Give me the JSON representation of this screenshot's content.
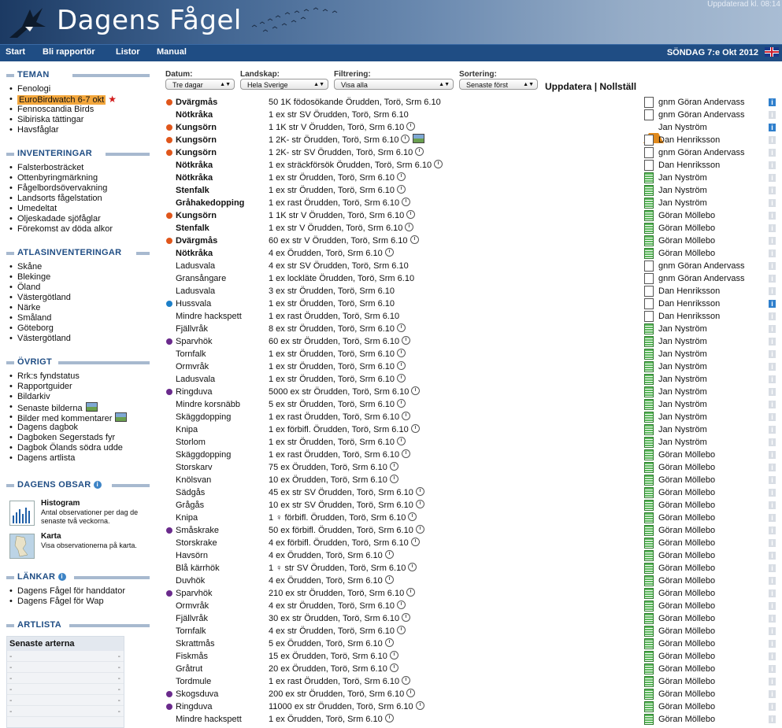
{
  "header": {
    "title": "Dagens Fågel",
    "updated": "Uppdaterad kl. 08:14"
  },
  "nav": {
    "items": [
      "Start",
      "Bli rapportör",
      "Listor",
      "Manual"
    ],
    "date": "SÖNDAG 7:e Okt 2012"
  },
  "sidebar": {
    "teman": {
      "title": "TEMAN",
      "items": [
        "Fenologi",
        "EuroBirdwatch 6-7 okt",
        "Fennoscandia Birds",
        "Sibiriska tättingar",
        "Havsfåglar"
      ]
    },
    "inventeringar": {
      "title": "INVENTERINGAR",
      "items": [
        "Falsterbosträcket",
        "Ottenbyringmärkning",
        "Fågelbordsövervakning",
        "Landsorts fågelstation",
        "Umedeltat",
        "Oljeskadade sjöfåglar",
        "Förekomst av döda alkor"
      ]
    },
    "atlas": {
      "title": "ATLASINVENTERINGAR",
      "items": [
        "Skåne",
        "Blekinge",
        "Öland",
        "Västergötland",
        "Närke",
        "Småland",
        "Göteborg",
        "Västergötland"
      ]
    },
    "ovrigt": {
      "title": "ÖVRIGT",
      "items": [
        "Rrk:s fyndstatus",
        "Rapportguider",
        "Bildarkiv",
        "Senaste bilderna",
        "Bilder med kommentarer",
        "Dagens dagbok",
        "Dagboken Segerstads fyr",
        "Dagbok Ölands södra udde",
        "Dagens artlista"
      ]
    },
    "obsar": {
      "title": "DAGENS OBSAR",
      "histogram_title": "Histogram",
      "histogram_desc": "Antal observationer per dag de senaste två veckorna.",
      "karta_title": "Karta",
      "karta_desc": "Visa observationerna på karta."
    },
    "lankar": {
      "title": "LÄNKAR",
      "items": [
        "Dagens Fågel för handdator",
        "Dagens Fågel för Wap"
      ]
    },
    "artlista": {
      "title": "ARTLISTA",
      "box_title": "Senaste arterna",
      "dash": "-"
    }
  },
  "filters": {
    "datum_label": "Datum:",
    "datum_value": "Tre dagar",
    "landskap_label": "Landskap:",
    "landskap_value": "Hela Sverige",
    "filtrering_label": "Filtrering:",
    "filtrering_value": "Visa alla",
    "sortering_label": "Sortering:",
    "sortering_value": "Senaste först",
    "uppdatera": "Uppdatera",
    "sep": "|",
    "nollstall": "Nollställ"
  },
  "colors": {
    "orange": "#e0561b",
    "blue": "#1c7fc8",
    "purple": "#6a2a8c"
  },
  "observations": [
    {
      "species": "Dvärgmås",
      "bold": true,
      "dot": "orange",
      "obs": "50 1K födosökande Örudden, Torö, Srm 6.10",
      "clock": false,
      "camera": false,
      "icon": "doc",
      "reporter": "gnm Göran Andervass",
      "info": true
    },
    {
      "species": "Nötkråka",
      "bold": true,
      "dot": "",
      "obs": "1 ex str SV Örudden, Torö, Srm 6.10",
      "clock": false,
      "camera": false,
      "icon": "doc",
      "reporter": "gnm Göran Andervass",
      "info": false
    },
    {
      "species": "Kungsörn",
      "bold": true,
      "dot": "orange",
      "obs": "1 1K str V Örudden, Torö, Srm 6.10",
      "clock": true,
      "camera": false,
      "icon": "warn",
      "reporter": "Jan Nyström",
      "info": true
    },
    {
      "species": "Kungsörn",
      "bold": true,
      "dot": "orange",
      "obs": "1 2K- str Örudden, Torö, Srm 6.10",
      "clock": true,
      "camera": true,
      "icon": "doc",
      "reporter": "Dan Henriksson",
      "info": false
    },
    {
      "species": "Kungsörn",
      "bold": true,
      "dot": "orange",
      "obs": "1 2K- str SV Örudden, Torö, Srm 6.10",
      "clock": true,
      "camera": false,
      "icon": "doc",
      "reporter": "gnm Göran Andervass",
      "info": false
    },
    {
      "species": "Nötkråka",
      "bold": true,
      "dot": "",
      "obs": "1 ex sträckförsök Örudden, Torö, Srm 6.10",
      "clock": true,
      "camera": false,
      "icon": "doc",
      "reporter": "Dan Henriksson",
      "info": false
    },
    {
      "species": "Nötkråka",
      "bold": true,
      "dot": "",
      "obs": "1 ex str Örudden, Torö, Srm 6.10",
      "clock": true,
      "camera": false,
      "icon": "green",
      "reporter": "Jan Nyström",
      "info": false
    },
    {
      "species": "Stenfalk",
      "bold": true,
      "dot": "",
      "obs": "1 ex str Örudden, Torö, Srm 6.10",
      "clock": true,
      "camera": false,
      "icon": "green",
      "reporter": "Jan Nyström",
      "info": false
    },
    {
      "species": "Gråhakedopping",
      "bold": true,
      "dot": "",
      "obs": "1 ex rast Örudden, Torö, Srm 6.10",
      "clock": true,
      "camera": false,
      "icon": "green",
      "reporter": "Jan Nyström",
      "info": false
    },
    {
      "species": "Kungsörn",
      "bold": true,
      "dot": "orange",
      "obs": "1 1K str V Örudden, Torö, Srm 6.10",
      "clock": true,
      "camera": false,
      "icon": "green",
      "reporter": "Göran Möllebo",
      "info": false
    },
    {
      "species": "Stenfalk",
      "bold": true,
      "dot": "",
      "obs": "1 ex str V Örudden, Torö, Srm 6.10",
      "clock": true,
      "camera": false,
      "icon": "green",
      "reporter": "Göran Möllebo",
      "info": false
    },
    {
      "species": "Dvärgmås",
      "bold": true,
      "dot": "orange",
      "obs": "60 ex str V Örudden, Torö, Srm 6.10",
      "clock": true,
      "camera": false,
      "icon": "green",
      "reporter": "Göran Möllebo",
      "info": false
    },
    {
      "species": "Nötkråka",
      "bold": true,
      "dot": "",
      "obs": "4 ex Örudden, Torö, Srm 6.10",
      "clock": true,
      "camera": false,
      "icon": "green",
      "reporter": "Göran Möllebo",
      "info": false
    },
    {
      "species": "Ladusvala",
      "bold": false,
      "dot": "",
      "obs": "4 ex str SV Örudden, Torö, Srm 6.10",
      "clock": false,
      "camera": false,
      "icon": "doc",
      "reporter": "gnm Göran Andervass",
      "info": false
    },
    {
      "species": "Gransångare",
      "bold": false,
      "dot": "",
      "obs": "1 ex lockläte Örudden, Torö, Srm 6.10",
      "clock": false,
      "camera": false,
      "icon": "doc",
      "reporter": "gnm Göran Andervass",
      "info": false
    },
    {
      "species": "Ladusvala",
      "bold": false,
      "dot": "",
      "obs": "3 ex str Örudden, Torö, Srm 6.10",
      "clock": false,
      "camera": false,
      "icon": "doc",
      "reporter": "Dan Henriksson",
      "info": false
    },
    {
      "species": "Hussvala",
      "bold": false,
      "dot": "blue",
      "obs": "1 ex str Örudden, Torö, Srm 6.10",
      "clock": false,
      "camera": false,
      "icon": "doc",
      "reporter": "Dan Henriksson",
      "info": true
    },
    {
      "species": "Mindre hackspett",
      "bold": false,
      "dot": "",
      "obs": "1 ex rast Örudden, Torö, Srm 6.10",
      "clock": false,
      "camera": false,
      "icon": "doc",
      "reporter": "Dan Henriksson",
      "info": false
    },
    {
      "species": "Fjällvråk",
      "bold": false,
      "dot": "",
      "obs": "8 ex str Örudden, Torö, Srm 6.10",
      "clock": true,
      "camera": false,
      "icon": "green",
      "reporter": "Jan Nyström",
      "info": false
    },
    {
      "species": "Sparvhök",
      "bold": false,
      "dot": "purple",
      "obs": "60 ex str Örudden, Torö, Srm 6.10",
      "clock": true,
      "camera": false,
      "icon": "green",
      "reporter": "Jan Nyström",
      "info": false
    },
    {
      "species": "Tornfalk",
      "bold": false,
      "dot": "",
      "obs": "1 ex str Örudden, Torö, Srm 6.10",
      "clock": true,
      "camera": false,
      "icon": "green",
      "reporter": "Jan Nyström",
      "info": false
    },
    {
      "species": "Ormvråk",
      "bold": false,
      "dot": "",
      "obs": "1 ex str Örudden, Torö, Srm 6.10",
      "clock": true,
      "camera": false,
      "icon": "green",
      "reporter": "Jan Nyström",
      "info": false
    },
    {
      "species": "Ladusvala",
      "bold": false,
      "dot": "",
      "obs": "1 ex str Örudden, Torö, Srm 6.10",
      "clock": true,
      "camera": false,
      "icon": "green",
      "reporter": "Jan Nyström",
      "info": false
    },
    {
      "species": "Ringduva",
      "bold": false,
      "dot": "purple",
      "obs": "5000 ex str Örudden, Torö, Srm 6.10",
      "clock": true,
      "camera": false,
      "icon": "green",
      "reporter": "Jan Nyström",
      "info": false
    },
    {
      "species": "Mindre korsnäbb",
      "bold": false,
      "dot": "",
      "obs": "5 ex str Örudden, Torö, Srm 6.10",
      "clock": true,
      "camera": false,
      "icon": "green",
      "reporter": "Jan Nyström",
      "info": false
    },
    {
      "species": "Skäggdopping",
      "bold": false,
      "dot": "",
      "obs": "1 ex rast Örudden, Torö, Srm 6.10",
      "clock": true,
      "camera": false,
      "icon": "green",
      "reporter": "Jan Nyström",
      "info": false
    },
    {
      "species": "Knipa",
      "bold": false,
      "dot": "",
      "obs": "1 ex förbifl. Örudden, Torö, Srm 6.10",
      "clock": true,
      "camera": false,
      "icon": "green",
      "reporter": "Jan Nyström",
      "info": false
    },
    {
      "species": "Storlom",
      "bold": false,
      "dot": "",
      "obs": "1 ex str Örudden, Torö, Srm 6.10",
      "clock": true,
      "camera": false,
      "icon": "green",
      "reporter": "Jan Nyström",
      "info": false
    },
    {
      "species": "Skäggdopping",
      "bold": false,
      "dot": "",
      "obs": "1 ex rast Örudden, Torö, Srm 6.10",
      "clock": true,
      "camera": false,
      "icon": "green",
      "reporter": "Göran Möllebo",
      "info": false
    },
    {
      "species": "Storskarv",
      "bold": false,
      "dot": "",
      "obs": "75 ex Örudden, Torö, Srm 6.10",
      "clock": true,
      "camera": false,
      "icon": "green",
      "reporter": "Göran Möllebo",
      "info": false
    },
    {
      "species": "Knölsvan",
      "bold": false,
      "dot": "",
      "obs": "10 ex Örudden, Torö, Srm 6.10",
      "clock": true,
      "camera": false,
      "icon": "green",
      "reporter": "Göran Möllebo",
      "info": false
    },
    {
      "species": "Sädgås",
      "bold": false,
      "dot": "",
      "obs": "45 ex str SV Örudden, Torö, Srm 6.10",
      "clock": true,
      "camera": false,
      "icon": "green",
      "reporter": "Göran Möllebo",
      "info": false
    },
    {
      "species": "Grågås",
      "bold": false,
      "dot": "",
      "obs": "10 ex str SV Örudden, Torö, Srm 6.10",
      "clock": true,
      "camera": false,
      "icon": "green",
      "reporter": "Göran Möllebo",
      "info": false
    },
    {
      "species": "Knipa",
      "bold": false,
      "dot": "",
      "obs": "1 ♀ förbifl. Örudden, Torö, Srm 6.10",
      "clock": true,
      "camera": false,
      "icon": "green",
      "reporter": "Göran Möllebo",
      "info": false
    },
    {
      "species": "Småskrake",
      "bold": false,
      "dot": "purple",
      "obs": "50 ex förbifl. Örudden, Torö, Srm 6.10",
      "clock": true,
      "camera": false,
      "icon": "green",
      "reporter": "Göran Möllebo",
      "info": false
    },
    {
      "species": "Storskrake",
      "bold": false,
      "dot": "",
      "obs": "4 ex förbifl. Örudden, Torö, Srm 6.10",
      "clock": true,
      "camera": false,
      "icon": "green",
      "reporter": "Göran Möllebo",
      "info": false
    },
    {
      "species": "Havsörn",
      "bold": false,
      "dot": "",
      "obs": "4 ex Örudden, Torö, Srm 6.10",
      "clock": true,
      "camera": false,
      "icon": "green",
      "reporter": "Göran Möllebo",
      "info": false
    },
    {
      "species": "Blå kärrhök",
      "bold": false,
      "dot": "",
      "obs": "1 ♀ str SV Örudden, Torö, Srm 6.10",
      "clock": true,
      "camera": false,
      "icon": "green",
      "reporter": "Göran Möllebo",
      "info": false
    },
    {
      "species": "Duvhök",
      "bold": false,
      "dot": "",
      "obs": "4 ex Örudden, Torö, Srm 6.10",
      "clock": true,
      "camera": false,
      "icon": "green",
      "reporter": "Göran Möllebo",
      "info": false
    },
    {
      "species": "Sparvhök",
      "bold": false,
      "dot": "purple",
      "obs": "210 ex str Örudden, Torö, Srm 6.10",
      "clock": true,
      "camera": false,
      "icon": "green",
      "reporter": "Göran Möllebo",
      "info": false
    },
    {
      "species": "Ormvråk",
      "bold": false,
      "dot": "",
      "obs": "4 ex str Örudden, Torö, Srm 6.10",
      "clock": true,
      "camera": false,
      "icon": "green",
      "reporter": "Göran Möllebo",
      "info": false
    },
    {
      "species": "Fjällvråk",
      "bold": false,
      "dot": "",
      "obs": "30 ex str Örudden, Torö, Srm 6.10",
      "clock": true,
      "camera": false,
      "icon": "green",
      "reporter": "Göran Möllebo",
      "info": false
    },
    {
      "species": "Tornfalk",
      "bold": false,
      "dot": "",
      "obs": "4 ex str Örudden, Torö, Srm 6.10",
      "clock": true,
      "camera": false,
      "icon": "green",
      "reporter": "Göran Möllebo",
      "info": false
    },
    {
      "species": "Skrattmås",
      "bold": false,
      "dot": "",
      "obs": "5 ex Örudden, Torö, Srm 6.10",
      "clock": true,
      "camera": false,
      "icon": "green",
      "reporter": "Göran Möllebo",
      "info": false
    },
    {
      "species": "Fiskmås",
      "bold": false,
      "dot": "",
      "obs": "15 ex Örudden, Torö, Srm 6.10",
      "clock": true,
      "camera": false,
      "icon": "green",
      "reporter": "Göran Möllebo",
      "info": false
    },
    {
      "species": "Gråtrut",
      "bold": false,
      "dot": "",
      "obs": "20 ex Örudden, Torö, Srm 6.10",
      "clock": true,
      "camera": false,
      "icon": "green",
      "reporter": "Göran Möllebo",
      "info": false
    },
    {
      "species": "Tordmule",
      "bold": false,
      "dot": "",
      "obs": "1 ex rast Örudden, Torö, Srm 6.10",
      "clock": true,
      "camera": false,
      "icon": "green",
      "reporter": "Göran Möllebo",
      "info": false
    },
    {
      "species": "Skogsduva",
      "bold": false,
      "dot": "purple",
      "obs": "200 ex str Örudden, Torö, Srm 6.10",
      "clock": true,
      "camera": false,
      "icon": "green",
      "reporter": "Göran Möllebo",
      "info": false
    },
    {
      "species": "Ringduva",
      "bold": false,
      "dot": "purple",
      "obs": "11000 ex str Örudden, Torö, Srm 6.10",
      "clock": true,
      "camera": false,
      "icon": "green",
      "reporter": "Göran Möllebo",
      "info": false
    },
    {
      "species": "Mindre hackspett",
      "bold": false,
      "dot": "",
      "obs": "1 ex Örudden, Torö, Srm 6.10",
      "clock": true,
      "camera": false,
      "icon": "green",
      "reporter": "Göran Möllebo",
      "info": false
    }
  ]
}
